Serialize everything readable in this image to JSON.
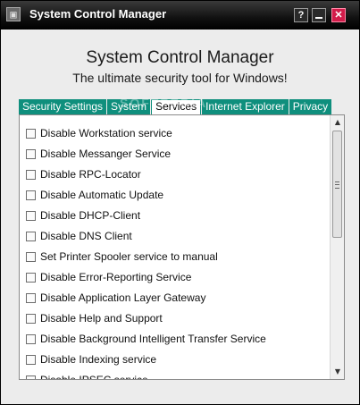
{
  "window": {
    "title": "System Control Manager",
    "app_icon_glyph": "▣"
  },
  "titlebar_buttons": {
    "help": "?",
    "close": "✕"
  },
  "header": {
    "title": "System Control Manager",
    "subtitle": "The ultimate security tool for Windows!"
  },
  "tabs": [
    {
      "label": "Security Settings"
    },
    {
      "label": "System"
    },
    {
      "label": "Services"
    },
    {
      "label": "Internet Explorer"
    },
    {
      "label": "Privacy"
    }
  ],
  "active_tab": "Services",
  "watermark": "SOFTPEDIA",
  "services": [
    {
      "label": "Disable Workstation service",
      "checked": false
    },
    {
      "label": "Disable Messanger Service",
      "checked": false
    },
    {
      "label": "Disable RPC-Locator",
      "checked": false
    },
    {
      "label": "Disable Automatic Update",
      "checked": false
    },
    {
      "label": "Disable DHCP-Client",
      "checked": false
    },
    {
      "label": "Disable DNS Client",
      "checked": false
    },
    {
      "label": "Set Printer Spooler service to manual",
      "checked": false
    },
    {
      "label": "Disable Error-Reporting Service",
      "checked": false
    },
    {
      "label": "Disable Application Layer Gateway",
      "checked": false
    },
    {
      "label": "Disable Help and Support",
      "checked": false
    },
    {
      "label": "Disable Background Intelligent Transfer Service",
      "checked": false
    },
    {
      "label": "Disable Indexing service",
      "checked": false
    },
    {
      "label": "Disable IPSEC service",
      "checked": false
    }
  ],
  "colors": {
    "titlebar": "#000000",
    "tab_accent": "#0f8f7d",
    "close_button": "#d21c4a"
  },
  "scrollbar": {
    "up_glyph": "▲",
    "down_glyph": "▼"
  }
}
